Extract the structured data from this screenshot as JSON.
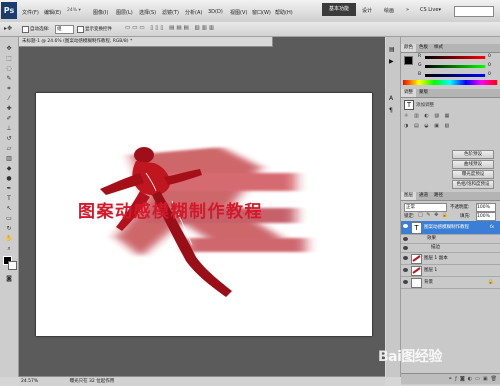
{
  "app": {
    "logo": "Ps"
  },
  "menubar": {
    "items": [
      "文件(F)",
      "编辑(E)",
      "图像(I)",
      "图层(L)",
      "选择(S)",
      "滤镜(T)",
      "分析(A)",
      "3D(D)",
      "视图(V)",
      "窗口(W)",
      "帮助(H)"
    ],
    "zoom_value": "24%"
  },
  "workspace": {
    "active": "基本功能",
    "others": [
      "设计",
      "绘画"
    ],
    "more": "»",
    "cslive": "CS Live▾"
  },
  "options": {
    "auto_select": "自动选择:",
    "auto_select_value": "组",
    "show_transform": "显示变换控件"
  },
  "document": {
    "tab_title": "未标题-1 @ 24.6% (图案动感模糊制作教程, RGB/8) *",
    "headline": "图案动感模糊制作教程",
    "zoom": "24.57%",
    "status": "曝光只在 32 位起作用"
  },
  "color_panel": {
    "tabs": [
      "颜色",
      "色板",
      "样式"
    ],
    "labels": [
      "R",
      "G",
      "B"
    ],
    "values": [
      "0",
      "0",
      "0"
    ]
  },
  "adjust_panel": {
    "tabs": [
      "调整",
      "蒙版"
    ],
    "heading": "添加调整",
    "buttons": [
      "色阶预设",
      "曲线预设",
      "曝光度预设",
      "色相/饱和度预设"
    ]
  },
  "layers_panel": {
    "tabs": [
      "图层",
      "通道",
      "路径"
    ],
    "blend_mode": "正常",
    "opacity_label": "不透明度:",
    "opacity_value": "100%",
    "lock_label": "锁定:",
    "fill_label": "填充:",
    "fill_value": "100%",
    "layers": [
      {
        "name": "图案动感模糊制作教程",
        "fx": "fx"
      },
      {
        "name": "效果"
      },
      {
        "name": "描边"
      },
      {
        "name": "图层 1 副本"
      },
      {
        "name": "图层 1"
      },
      {
        "name": "背景"
      }
    ]
  },
  "watermark": "Bai图经验"
}
